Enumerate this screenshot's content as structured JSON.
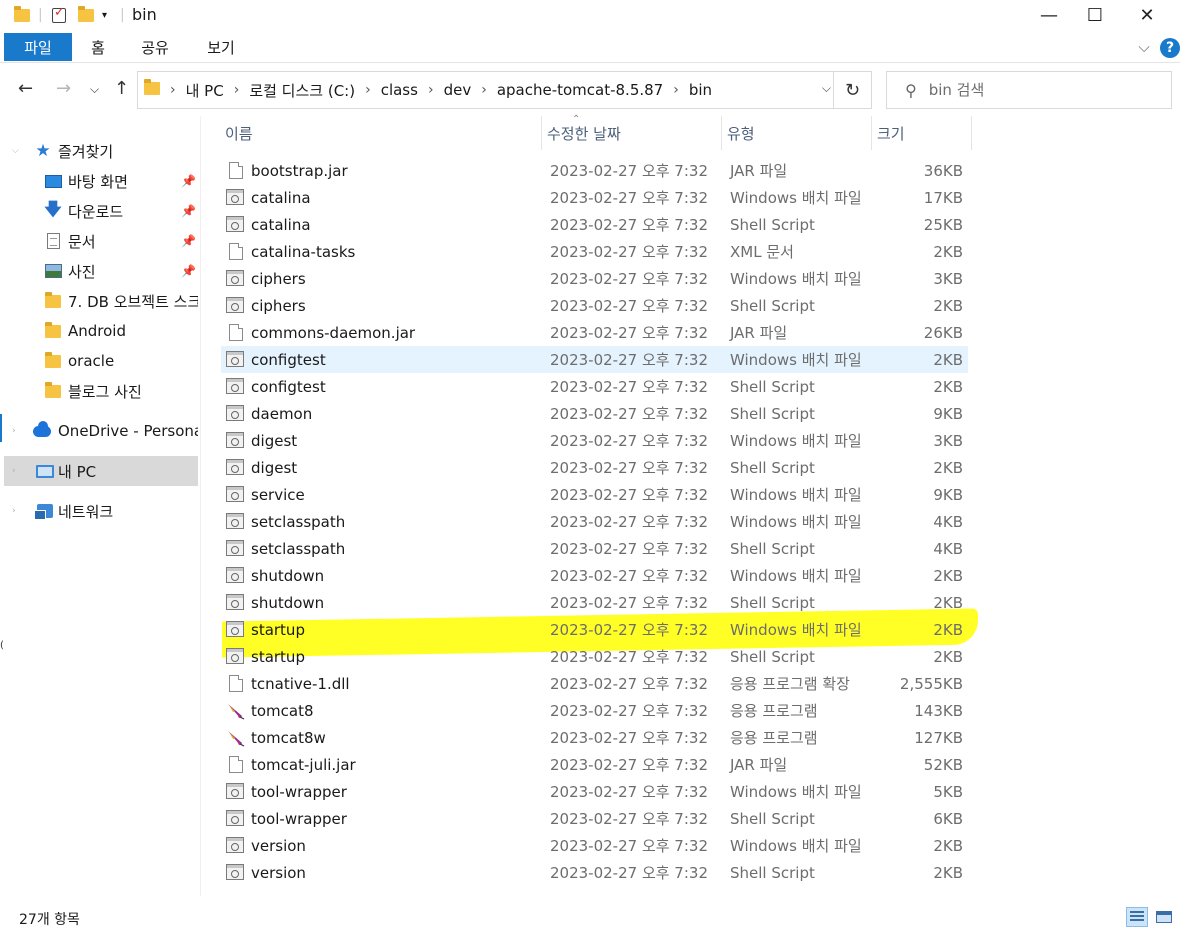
{
  "window": {
    "title": "bin",
    "minimize": "—",
    "maximize": "☐",
    "close": "✕"
  },
  "ribbon": {
    "tabs": [
      "파일",
      "홈",
      "공유",
      "보기"
    ],
    "collapse": "⌵",
    "help": "?"
  },
  "nav": {
    "back": "←",
    "forward": "→",
    "recent": "⌵",
    "up": "↑",
    "breadcrumb": [
      "내 PC",
      "로컬 디스크 (C:)",
      "class",
      "dev",
      "apache-tomcat-8.5.87",
      "bin"
    ],
    "search_placeholder": "bin 검색"
  },
  "sidebar": {
    "items": [
      {
        "label": "즐겨찾기",
        "icon": "star-icon"
      },
      {
        "label": "바탕 화면",
        "icon": "desktop-icon",
        "pinned": true
      },
      {
        "label": "다운로드",
        "icon": "download-icon",
        "pinned": true
      },
      {
        "label": "문서",
        "icon": "document-icon",
        "pinned": true
      },
      {
        "label": "사진",
        "icon": "pictures-icon",
        "pinned": true
      },
      {
        "label": "7. DB 오브젝트 스크",
        "icon": "folder-icon"
      },
      {
        "label": "Android",
        "icon": "folder-icon"
      },
      {
        "label": "oracle",
        "icon": "folder-icon"
      },
      {
        "label": "블로그 사진",
        "icon": "folder-icon"
      },
      {
        "label": "OneDrive - Personal",
        "icon": "onedrive-icon"
      },
      {
        "label": "내 PC",
        "icon": "pc-icon",
        "selected": true
      },
      {
        "label": "네트워크",
        "icon": "network-icon"
      }
    ]
  },
  "columns": {
    "name": "이름",
    "date": "수정한 날짜",
    "type": "유형",
    "size": "크기"
  },
  "files": [
    {
      "name": "bootstrap.jar",
      "date": "2023-02-27 오후 7:32",
      "type": "JAR 파일",
      "size": "36KB",
      "icon": "blank"
    },
    {
      "name": "catalina",
      "date": "2023-02-27 오후 7:32",
      "type": "Windows 배치 파일",
      "size": "17KB",
      "icon": "script"
    },
    {
      "name": "catalina",
      "date": "2023-02-27 오후 7:32",
      "type": "Shell Script",
      "size": "25KB",
      "icon": "script"
    },
    {
      "name": "catalina-tasks",
      "date": "2023-02-27 오후 7:32",
      "type": "XML 문서",
      "size": "2KB",
      "icon": "blank"
    },
    {
      "name": "ciphers",
      "date": "2023-02-27 오후 7:32",
      "type": "Windows 배치 파일",
      "size": "3KB",
      "icon": "script"
    },
    {
      "name": "ciphers",
      "date": "2023-02-27 오후 7:32",
      "type": "Shell Script",
      "size": "2KB",
      "icon": "script"
    },
    {
      "name": "commons-daemon.jar",
      "date": "2023-02-27 오후 7:32",
      "type": "JAR 파일",
      "size": "26KB",
      "icon": "blank"
    },
    {
      "name": "configtest",
      "date": "2023-02-27 오후 7:32",
      "type": "Windows 배치 파일",
      "size": "2KB",
      "icon": "script"
    },
    {
      "name": "configtest",
      "date": "2023-02-27 오후 7:32",
      "type": "Shell Script",
      "size": "2KB",
      "icon": "script"
    },
    {
      "name": "daemon",
      "date": "2023-02-27 오후 7:32",
      "type": "Shell Script",
      "size": "9KB",
      "icon": "script"
    },
    {
      "name": "digest",
      "date": "2023-02-27 오후 7:32",
      "type": "Windows 배치 파일",
      "size": "3KB",
      "icon": "script"
    },
    {
      "name": "digest",
      "date": "2023-02-27 오후 7:32",
      "type": "Shell Script",
      "size": "2KB",
      "icon": "script"
    },
    {
      "name": "service",
      "date": "2023-02-27 오후 7:32",
      "type": "Windows 배치 파일",
      "size": "9KB",
      "icon": "script"
    },
    {
      "name": "setclasspath",
      "date": "2023-02-27 오후 7:32",
      "type": "Windows 배치 파일",
      "size": "4KB",
      "icon": "script"
    },
    {
      "name": "setclasspath",
      "date": "2023-02-27 오후 7:32",
      "type": "Shell Script",
      "size": "4KB",
      "icon": "script"
    },
    {
      "name": "shutdown",
      "date": "2023-02-27 오후 7:32",
      "type": "Windows 배치 파일",
      "size": "2KB",
      "icon": "script"
    },
    {
      "name": "shutdown",
      "date": "2023-02-27 오후 7:32",
      "type": "Shell Script",
      "size": "2KB",
      "icon": "script"
    },
    {
      "name": "startup",
      "date": "2023-02-27 오후 7:32",
      "type": "Windows 배치 파일",
      "size": "2KB",
      "icon": "script"
    },
    {
      "name": "startup",
      "date": "2023-02-27 오후 7:32",
      "type": "Shell Script",
      "size": "2KB",
      "icon": "script"
    },
    {
      "name": "tcnative-1.dll",
      "date": "2023-02-27 오후 7:32",
      "type": "응용 프로그램 확장",
      "size": "2,555KB",
      "icon": "blank"
    },
    {
      "name": "tomcat8",
      "date": "2023-02-27 오후 7:32",
      "type": "응용 프로그램",
      "size": "143KB",
      "icon": "feather"
    },
    {
      "name": "tomcat8w",
      "date": "2023-02-27 오후 7:32",
      "type": "응용 프로그램",
      "size": "127KB",
      "icon": "feather"
    },
    {
      "name": "tomcat-juli.jar",
      "date": "2023-02-27 오후 7:32",
      "type": "JAR 파일",
      "size": "52KB",
      "icon": "blank"
    },
    {
      "name": "tool-wrapper",
      "date": "2023-02-27 오후 7:32",
      "type": "Windows 배치 파일",
      "size": "5KB",
      "icon": "script"
    },
    {
      "name": "tool-wrapper",
      "date": "2023-02-27 오후 7:32",
      "type": "Shell Script",
      "size": "6KB",
      "icon": "script"
    },
    {
      "name": "version",
      "date": "2023-02-27 오후 7:32",
      "type": "Windows 배치 파일",
      "size": "2KB",
      "icon": "script"
    },
    {
      "name": "version",
      "date": "2023-02-27 오후 7:32",
      "type": "Shell Script",
      "size": "2KB",
      "icon": "script"
    }
  ],
  "hover_row": 7,
  "highlighted_row": 17,
  "status": {
    "item_count": "27개 항목"
  },
  "colors": {
    "accent": "#1979ca",
    "highlight": "#ffff00",
    "hover": "#e5f3ff",
    "selected": "#d9d9d9"
  }
}
